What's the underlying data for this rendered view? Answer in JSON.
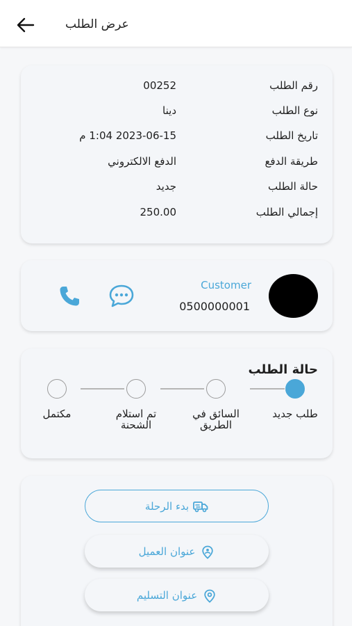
{
  "appbar": {
    "title": "عرض الطلب",
    "back_icon": "arrow-left-icon"
  },
  "order_info": {
    "rows": [
      {
        "label": "رقم الطلب",
        "value": "00252"
      },
      {
        "label": "نوع الطلب",
        "value": "دينا"
      },
      {
        "label": "تاريخ الطلب",
        "value": "2023-06-15 1:04 م"
      },
      {
        "label": "طريقة الدفع",
        "value": "الدفع الالكتروني"
      },
      {
        "label": "حالة الطلب",
        "value": "جديد"
      },
      {
        "label": "إجمالي الطلب",
        "value": "250.00"
      }
    ]
  },
  "customer": {
    "name": "Customer",
    "phone": "0500000001",
    "chat_icon": "chat-bubble-icon",
    "phone_icon": "phone-icon"
  },
  "order_status": {
    "title": "حالة الطلب",
    "steps": [
      {
        "label": "طلب جديد",
        "active": true
      },
      {
        "label": "السائق في الطريق",
        "active": false
      },
      {
        "label": "تم استلام الشحنة",
        "active": false
      },
      {
        "label": "مكتمل",
        "active": false
      }
    ]
  },
  "actions": {
    "start_trip": "بدء الرحلة",
    "customer_address": "عنوان العميل",
    "delivery_address": "عنوان التسليم"
  },
  "colors": {
    "accent": "#4aa7d8",
    "card_bg": "#f4f6f9",
    "page_bg": "#f6f7f9"
  }
}
